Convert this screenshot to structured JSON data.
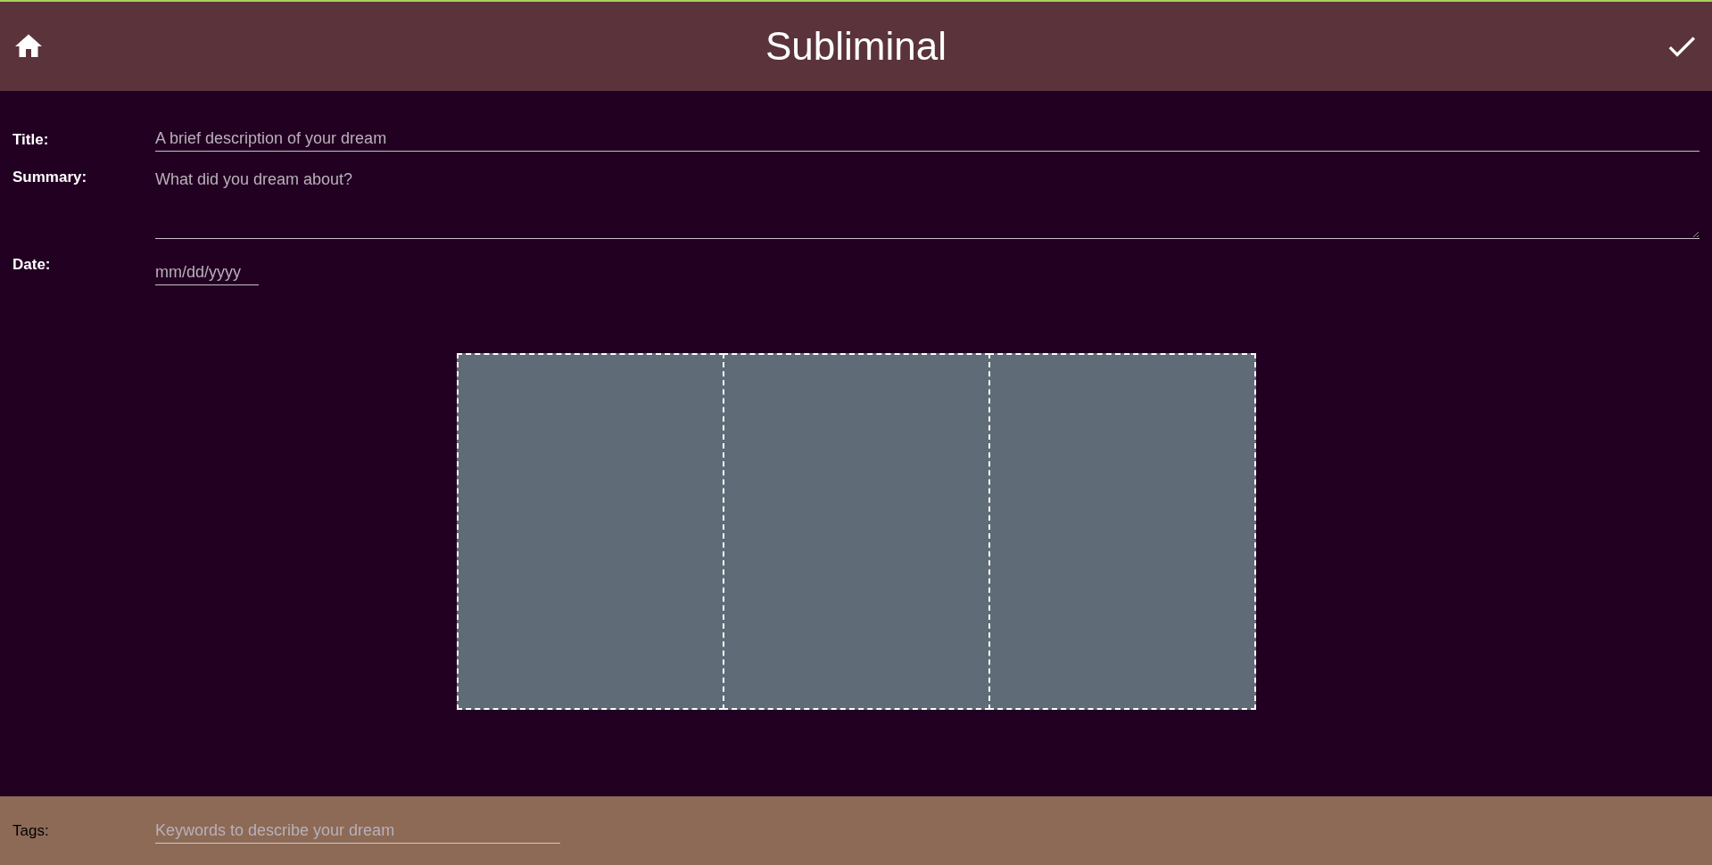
{
  "header": {
    "title": "Subliminal"
  },
  "fields": [
    {
      "kind": "line",
      "label": "Title:",
      "placeholder": "A brief description of your dream"
    },
    {
      "kind": "area",
      "label": "Summary:",
      "placeholder": "What did you dream about?"
    },
    {
      "kind": "date",
      "label": "Date:",
      "placeholder": "mm/dd/yyyy"
    }
  ],
  "image_slots": [
    {
      "kind": "empty"
    },
    {
      "kind": "empty"
    },
    {
      "kind": "empty"
    }
  ],
  "footer": {
    "label": "Tags:",
    "placeholder": "Keywords to describe your dream"
  }
}
